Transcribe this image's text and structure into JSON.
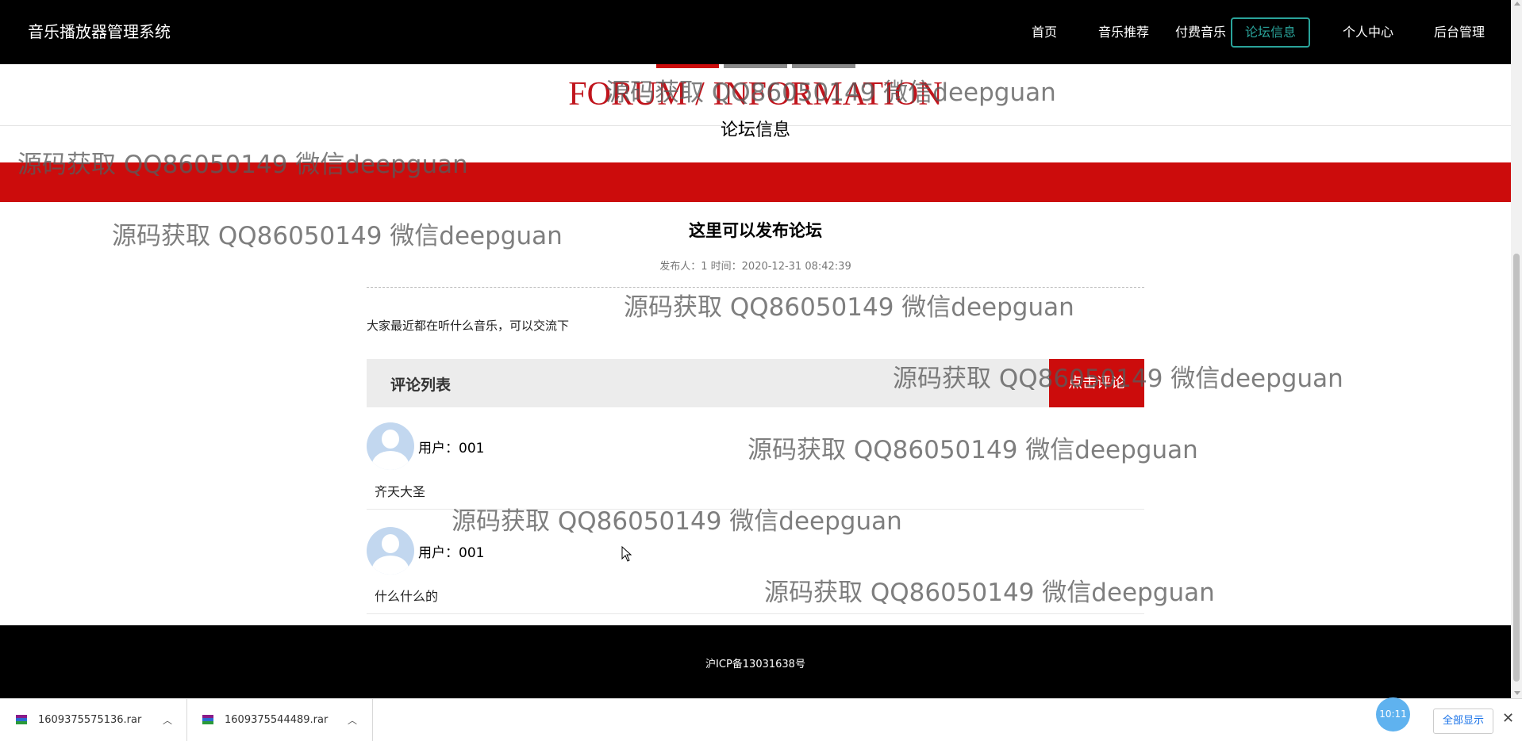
{
  "navbar": {
    "brand": "音乐播放器管理系统",
    "items": [
      {
        "label": "首页",
        "active": false
      },
      {
        "label": "音乐推荐",
        "active": false
      },
      {
        "label": "付费音乐",
        "active": false
      },
      {
        "label": "论坛信息",
        "active": true
      },
      {
        "label": "个人中心",
        "active": false
      },
      {
        "label": "后台管理",
        "active": false
      }
    ]
  },
  "section": {
    "title_en": "FORUM / INFORMATION",
    "title_cn": "论坛信息"
  },
  "post": {
    "title": "这里可以发布论坛",
    "meta": "发布人：1 时间：2020-12-31 08:42:39",
    "body": "大家最近都在听什么音乐，可以交流下"
  },
  "comments": {
    "heading": "评论列表",
    "button_label": "点击评论",
    "items": [
      {
        "user": "用户：001",
        "text": "齐天大圣"
      },
      {
        "user": "用户：001",
        "text": "什么什么的"
      }
    ]
  },
  "footer": {
    "icp": "沪ICP备13031638号"
  },
  "watermark": {
    "text": "源码获取 QQ86050149 微信deepguan"
  },
  "downloads": {
    "items": [
      {
        "name": "1609375575136.rar"
      },
      {
        "name": "1609375544489.rar"
      }
    ],
    "show_all": "全部显示",
    "clock": "10:11"
  },
  "colors": {
    "accent_red": "#cc0c0c",
    "title_red": "#c0141c",
    "active_nav": "#2aa39a"
  },
  "icons": {
    "avatar": "user-avatar-icon",
    "archive": "rar-archive-icon",
    "chevron": "chevron-up-icon",
    "close": "close-icon"
  }
}
